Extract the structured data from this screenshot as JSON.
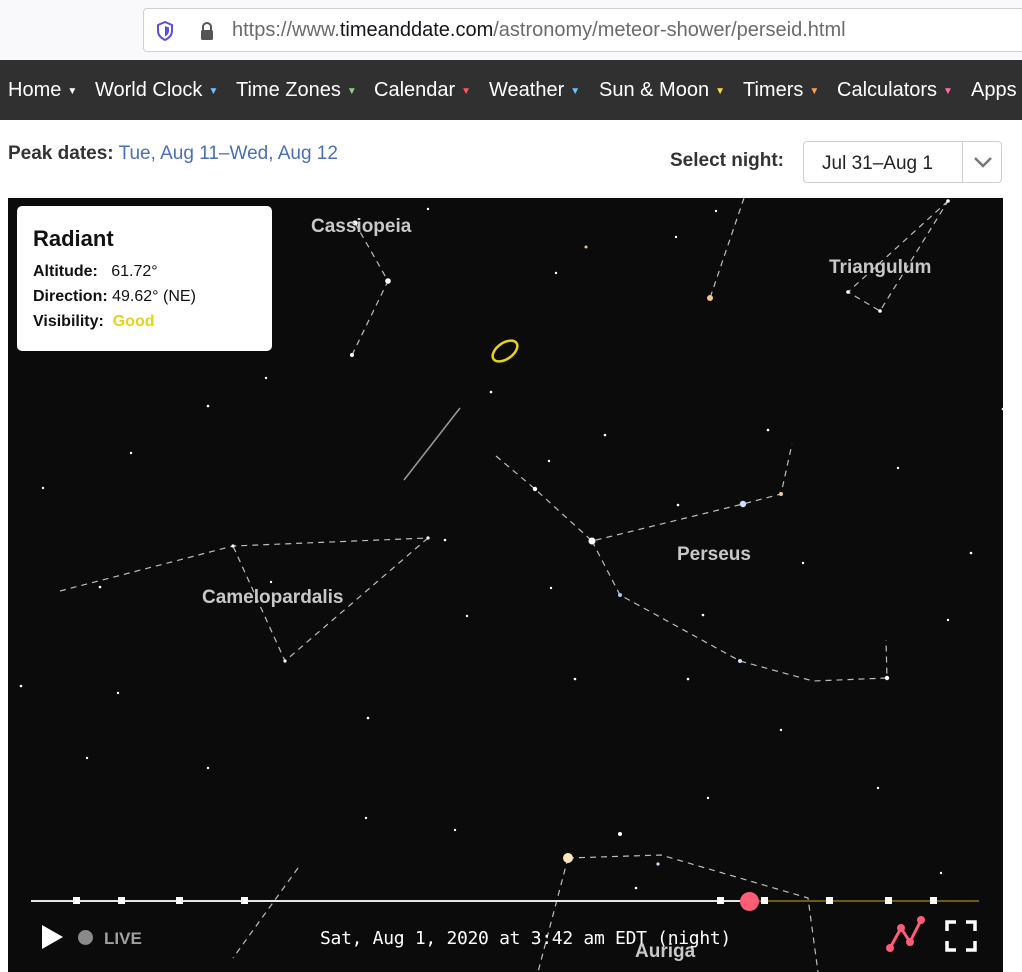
{
  "browser": {
    "url_prefix": "https://www.",
    "url_domain": "timeanddate.com",
    "url_path": "/astronomy/meteor-shower/perseid.html",
    "icons": [
      "shield-icon",
      "lock-icon"
    ]
  },
  "nav": {
    "items": [
      {
        "label": "Home",
        "caret_color": "#ffffff"
      },
      {
        "label": "World Clock",
        "caret_color": "#6ec2ff"
      },
      {
        "label": "Time Zones",
        "caret_color": "#8bd17c"
      },
      {
        "label": "Calendar",
        "caret_color": "#ff5a5a"
      },
      {
        "label": "Weather",
        "caret_color": "#6ec2ff"
      },
      {
        "label": "Sun & Moon",
        "caret_color": "#ffd84a"
      },
      {
        "label": "Timers",
        "caret_color": "#ff9f4a"
      },
      {
        "label": "Calculators",
        "caret_color": "#ff6fae"
      },
      {
        "label": "Apps",
        "caret_color": "#ffffff"
      }
    ],
    "caret": "▼"
  },
  "peak": {
    "label": "Peak dates:",
    "value": "Tue, Aug 11–Wed, Aug 12"
  },
  "select_night": {
    "label": "Select night:",
    "value": "Jul 31–Aug 1"
  },
  "radiant": {
    "title": "Radiant",
    "altitude_label": "Altitude:",
    "altitude_value": "61.72°",
    "direction_label": "Direction:",
    "direction_value": "49.62° (NE)",
    "visibility_label": "Visibility:",
    "visibility_value": "Good",
    "visibility_color": "#e6d21a"
  },
  "constellations": {
    "cassiopeia": "Cassiopeia",
    "triangulum": "Triangulum",
    "perseus": "Perseus",
    "camelopardalis": "Camelopardalis",
    "auriga": "Auriga"
  },
  "controls": {
    "live_label": "LIVE",
    "datetime": "Sat, Aug 1, 2020 at 3:42 am EDT (night)",
    "accent_color": "#ff5c77",
    "icons": [
      "play-icon",
      "chart-icon",
      "fullscreen-icon"
    ]
  }
}
